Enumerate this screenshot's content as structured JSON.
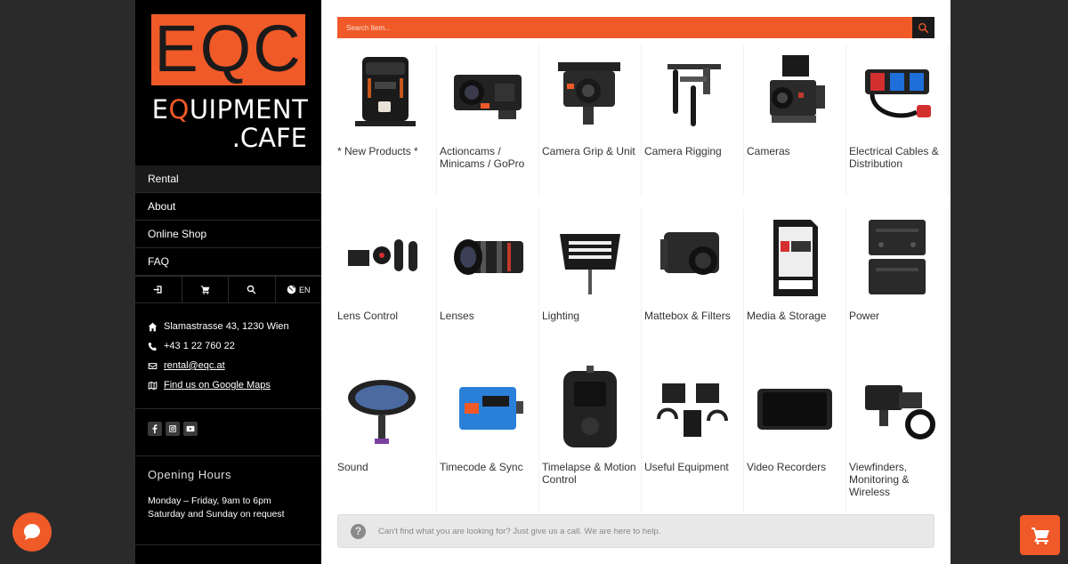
{
  "brand": {
    "logo_main": "EQC",
    "logo_word_pre": "E",
    "logo_word_q": "Q",
    "logo_word_post": "UIPMENT",
    "logo_suffix": ".CAFE"
  },
  "nav": {
    "items": [
      {
        "label": "Rental"
      },
      {
        "label": "About"
      },
      {
        "label": "Online Shop"
      },
      {
        "label": "FAQ"
      }
    ]
  },
  "iconbar": {
    "language": "EN"
  },
  "contact": {
    "address": "Slamastrasse 43, 1230 Wien",
    "phone": "+43 1 22 760 22",
    "email": "rental@eqc.at",
    "maps": "Find us on Google Maps"
  },
  "hours": {
    "title": "Opening Hours",
    "weekdays": "Monday – Friday, 9am to 6pm",
    "weekend": "Saturday and Sunday on request"
  },
  "search": {
    "placeholder": "Search Item..."
  },
  "categories": [
    {
      "label": "* New Products *"
    },
    {
      "label": "Actioncams / Minicams / GoPro"
    },
    {
      "label": "Camera Grip & Unit"
    },
    {
      "label": "Camera Rigging"
    },
    {
      "label": "Cameras"
    },
    {
      "label": "Electrical Cables & Distribution"
    },
    {
      "label": "Lens Control"
    },
    {
      "label": "Lenses"
    },
    {
      "label": "Lighting"
    },
    {
      "label": "Mattebox & Filters"
    },
    {
      "label": "Media & Storage"
    },
    {
      "label": "Power"
    },
    {
      "label": "Sound"
    },
    {
      "label": "Timecode & Sync"
    },
    {
      "label": "Timelapse & Motion Control"
    },
    {
      "label": "Useful Equipment"
    },
    {
      "label": "Video Recorders"
    },
    {
      "label": "Viewfinders, Monitoring & Wireless"
    }
  ],
  "help": {
    "text": "Can't find what you are looking for? Just give us a call. We are here to help."
  },
  "colors": {
    "accent": "#f05a28",
    "sidebar_bg": "#000000",
    "page_bg": "#2a2a2a"
  }
}
